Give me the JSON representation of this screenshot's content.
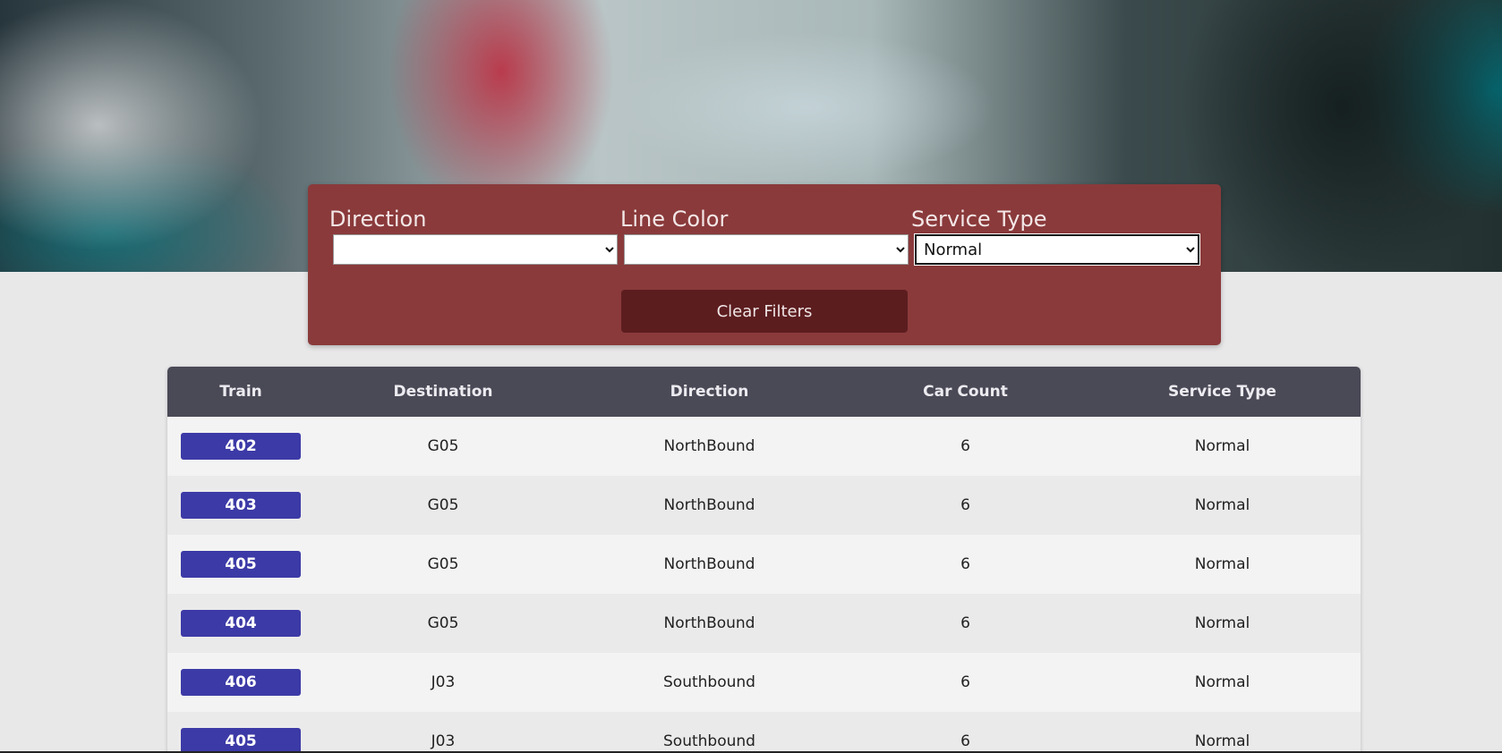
{
  "filters": {
    "direction": {
      "label": "Direction",
      "selected": ""
    },
    "line_color": {
      "label": "Line Color",
      "selected": ""
    },
    "service_type": {
      "label": "Service Type",
      "selected": "Normal"
    },
    "clear_label": "Clear Filters"
  },
  "table": {
    "headers": [
      "Train",
      "Destination",
      "Direction",
      "Car Count",
      "Service Type"
    ],
    "rows": [
      {
        "train": "402",
        "destination": "G05",
        "direction": "NorthBound",
        "car_count": "6",
        "service_type": "Normal"
      },
      {
        "train": "403",
        "destination": "G05",
        "direction": "NorthBound",
        "car_count": "6",
        "service_type": "Normal"
      },
      {
        "train": "405",
        "destination": "G05",
        "direction": "NorthBound",
        "car_count": "6",
        "service_type": "Normal"
      },
      {
        "train": "404",
        "destination": "G05",
        "direction": "NorthBound",
        "car_count": "6",
        "service_type": "Normal"
      },
      {
        "train": "406",
        "destination": "J03",
        "direction": "Southbound",
        "car_count": "6",
        "service_type": "Normal"
      },
      {
        "train": "405",
        "destination": "J03",
        "direction": "Southbound",
        "car_count": "6",
        "service_type": "Normal"
      }
    ]
  },
  "colors": {
    "panel": "#8a3a3b",
    "button": "#5c1d1f",
    "table_header": "#4a4956",
    "train_badge": "#3c3aa6"
  }
}
